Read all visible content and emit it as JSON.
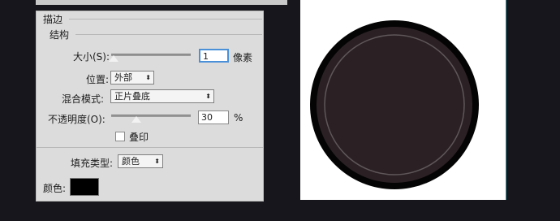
{
  "stroke_panel": {
    "title": "描边",
    "structure_title": "结构",
    "size_label": "大小(S):",
    "size_value": "1",
    "size_unit": "像素",
    "size_level": 0.0,
    "position_label": "位置:",
    "position_value": "外部",
    "blend_label": "混合模式:",
    "blend_value": "正片叠底",
    "opacity_label": "不透明度(O):",
    "opacity_value": "30",
    "opacity_unit": "%",
    "opacity_level": 0.3,
    "overprint_label": "叠印",
    "overprint_checked": false,
    "fill_type_label": "填充类型:",
    "fill_type_value": "颜色",
    "color_label": "颜色:",
    "color_value": "#000000"
  },
  "colors": {
    "background": "#17161c",
    "panel": "#dcdcdc",
    "circle_outer": "#050405",
    "circle_inner": "#2b2125",
    "circle_ring": "#5a5256",
    "focus_blue": "#4a90d9"
  },
  "icons": {
    "dropdown": "chevron-down-up-icon",
    "slider_thumb": "triangle-thumb-icon"
  }
}
